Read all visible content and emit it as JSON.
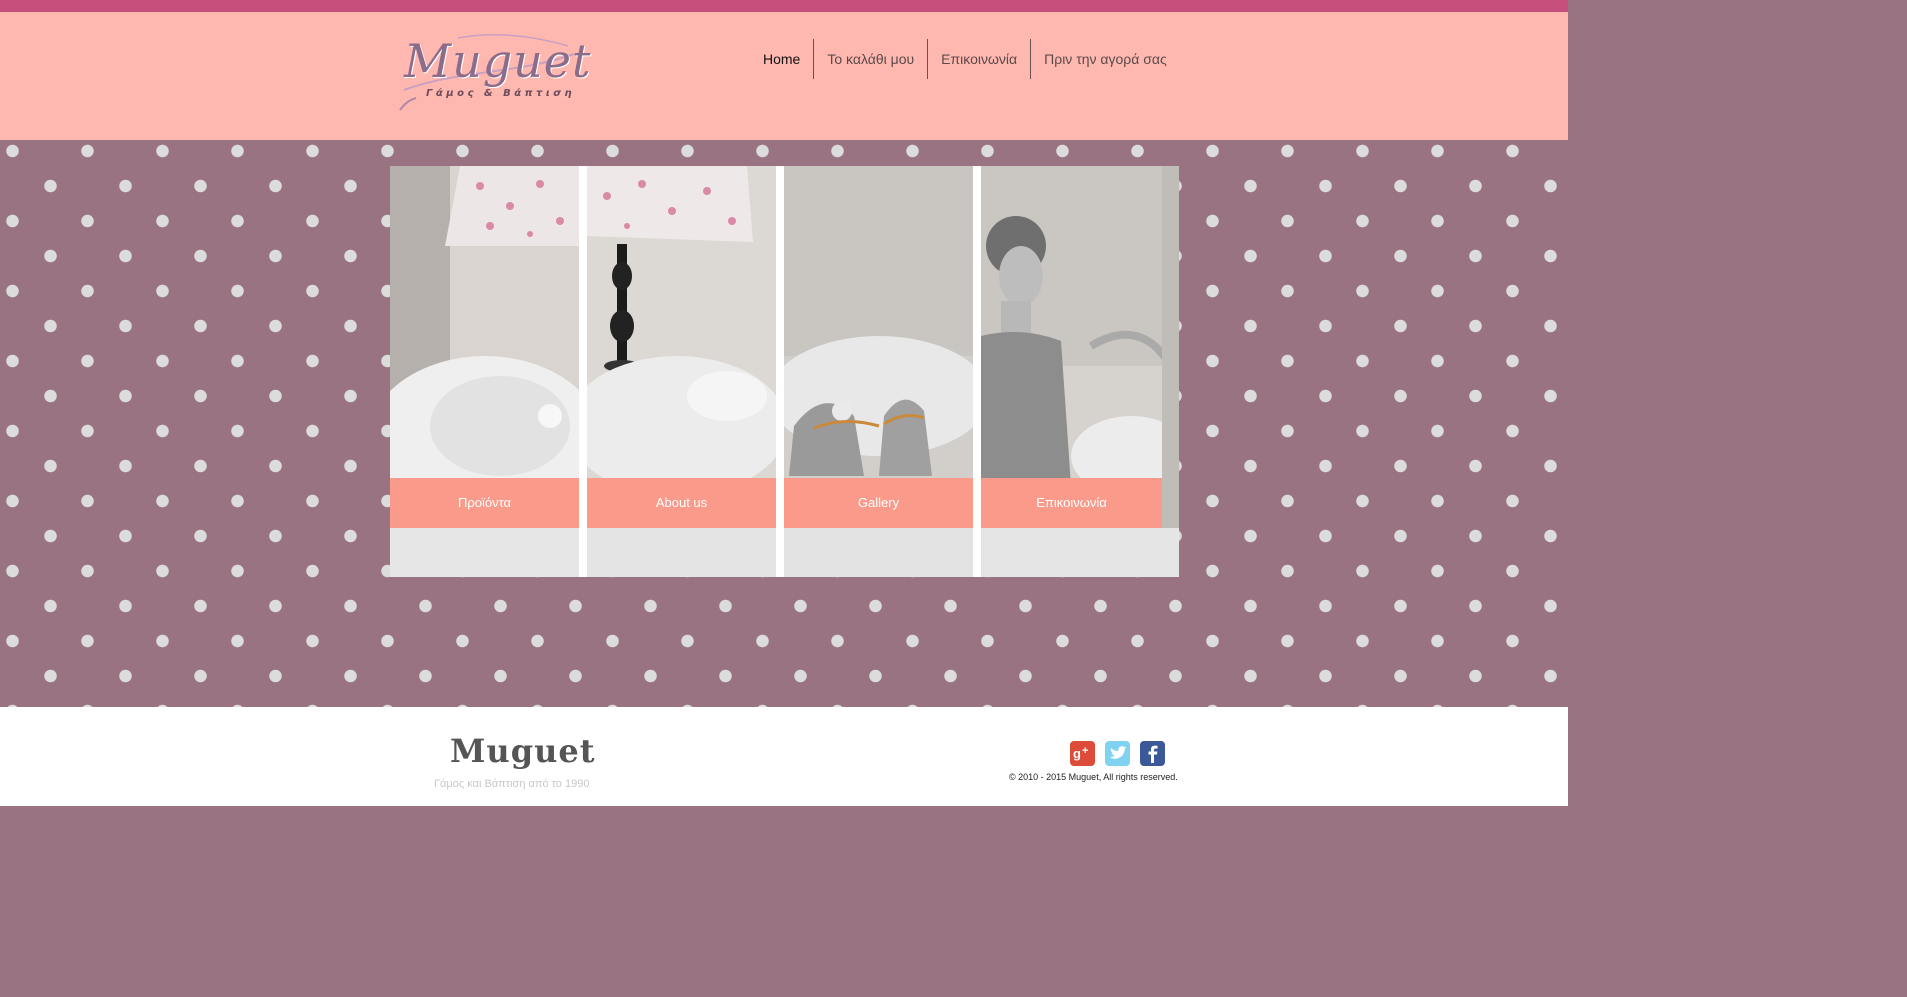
{
  "header": {
    "logo_text": "Muguet",
    "logo_subtitle": "Γάμος & Βάπτιση",
    "nav": [
      {
        "label": "Home"
      },
      {
        "label": "Το καλάθι μου"
      },
      {
        "label": "Επικοινωνία"
      },
      {
        "label": "Πριν την αγορά σας"
      }
    ]
  },
  "panels": [
    {
      "label": "Προϊόντα"
    },
    {
      "label": "About us"
    },
    {
      "label": "Gallery"
    },
    {
      "label": "Επικοινωνία"
    }
  ],
  "footer": {
    "title": "Muguet",
    "tagline": "Γάμος και Βάπτιση από το 1990",
    "social": [
      {
        "icon": "google-plus-icon",
        "color": "#dd4b39"
      },
      {
        "icon": "twitter-icon",
        "color": "#7fd3f0"
      },
      {
        "icon": "facebook-icon",
        "color": "#3b5998"
      }
    ],
    "copyright": "© 2010 - 2015 Muguet, All rights reserved."
  },
  "colors": {
    "top_bar": "#c74f7b",
    "header_bg": "#ffb8b0",
    "pattern_bg": "#9a7383",
    "panel_label_bg": "#f99a8a"
  }
}
